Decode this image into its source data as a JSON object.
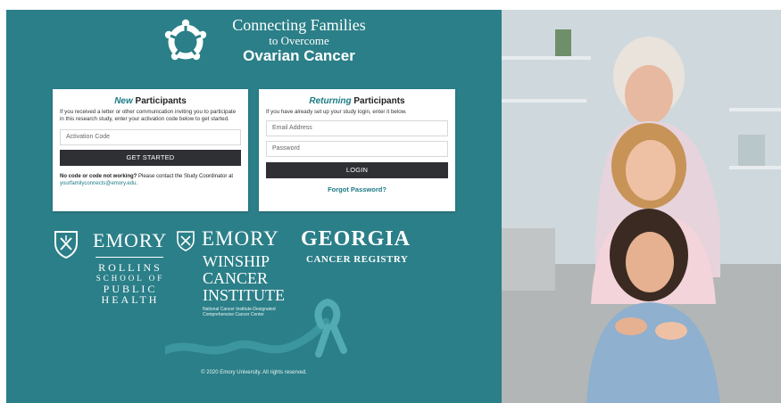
{
  "brand": {
    "line1": "Connecting Families",
    "line2": "to Overcome",
    "line3": "Ovarian Cancer"
  },
  "new_participants": {
    "title_emphasis": "New",
    "title_rest": " Participants",
    "description": "If you received a letter or other communication inviting you to participate in this research study, enter your activation code below to get started.",
    "activation_placeholder": "Activation Code",
    "button_label": "GET STARTED",
    "help_bold": "No code or code not working?",
    "help_text": " Please contact the Study Coordinator at ",
    "help_email": "yourfamilyconnects@emory.edu",
    "help_end": "."
  },
  "returning_participants": {
    "title_emphasis": "Returning",
    "title_rest": " Participants",
    "description": "If you have already set up your study login, enter it below.",
    "email_placeholder": "Email Address",
    "password_placeholder": "Password",
    "button_label": "LOGIN",
    "forgot_label": "Forgot Password?"
  },
  "partners": {
    "emory_rollins": {
      "word": "EMORY",
      "lines": [
        "ROLLINS",
        "SCHOOL OF",
        "PUBLIC",
        "HEALTH"
      ]
    },
    "emory_winship": {
      "word": "EMORY",
      "lines": [
        "WINSHIP",
        "CANCER",
        "INSTITUTE"
      ],
      "note_line1": "National Cancer Institute-Designated",
      "note_line2": "Comprehensive Cancer Center"
    },
    "georgia": {
      "word": "GEORGIA",
      "subtitle": "CANCER REGISTRY"
    }
  },
  "footer": {
    "copyright": "© 2020 Emory University. All rights reserved."
  },
  "colors": {
    "teal_panel": "#2b7f88",
    "accent": "#1c7a84",
    "button_dark": "#2e3033"
  }
}
